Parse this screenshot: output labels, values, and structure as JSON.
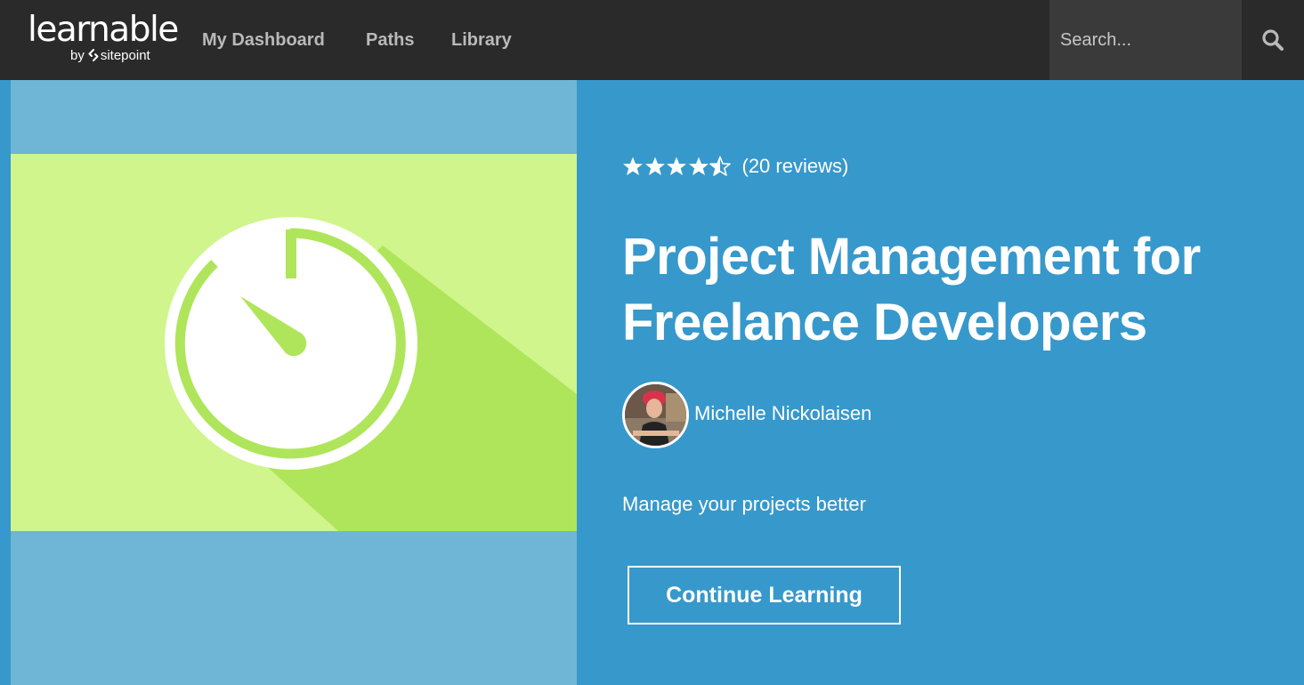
{
  "brand": {
    "name": "learnable",
    "sub_by": "by",
    "sub_name": "sitepoint",
    "icon": "sitepoint-mark-icon"
  },
  "nav": {
    "items": [
      {
        "label": "My Dashboard"
      },
      {
        "label": "Paths"
      },
      {
        "label": "Library"
      }
    ]
  },
  "search": {
    "placeholder": "Search...",
    "value": "",
    "icon": "search-icon"
  },
  "course": {
    "rating": 4.5,
    "rating_max": 5,
    "reviews_label": "(20 reviews)",
    "title_line1": "Project Management for",
    "title_line2": "Freelance Developers",
    "author": "Michelle Nickolaisen",
    "tagline": "Manage your projects better",
    "cta_label": "Continue Learning",
    "hero_icon": "stopwatch-icon"
  },
  "colors": {
    "topbar": "#2a2a2a",
    "accent_blue": "#3798cb",
    "hero_light_blue": "#6fb5d6",
    "hero_green": "#cff58c",
    "icon_green": "#afe55a"
  }
}
